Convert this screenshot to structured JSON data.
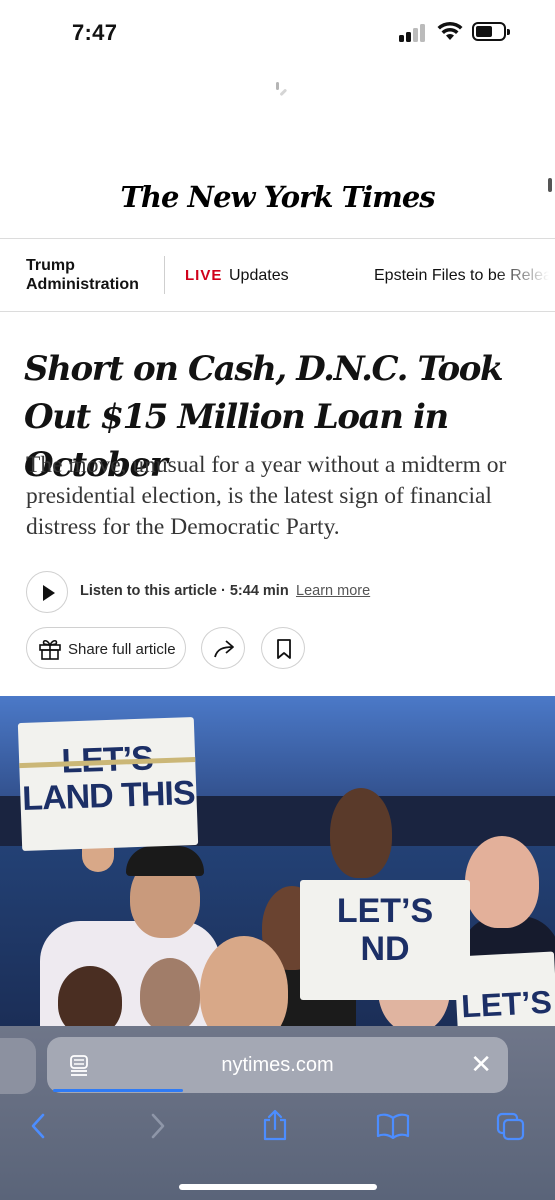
{
  "status_bar": {
    "time": "7:47"
  },
  "masthead": {
    "title": "The New York Times"
  },
  "ticker": {
    "section_line1": "Trump",
    "section_line2": "Administration",
    "live": "LIVE",
    "updates": "Updates",
    "next_item": "Epstein Files to be Releas"
  },
  "article": {
    "headline": "Short on Cash, D.N.C. Took Out $15 Million Loan in October",
    "summary": "The move, unusual for a year without a midterm or presidential election, is the latest sign of financial distress for the Democratic Party.",
    "listen_label": "Listen to this article · 5:44 min",
    "learn_more": "Learn more",
    "share_label": "Share full article"
  },
  "photo": {
    "sign_left_line1": "LET’S",
    "sign_left_line2": "LAND THIS",
    "sign_mid_line1": "LET’S",
    "sign_mid_line2": "ND",
    "sign_right": "LET’S"
  },
  "browser": {
    "url": "nytimes.com",
    "accent_color": "#2f7bf5"
  },
  "icons": [
    "play-icon",
    "gift-icon",
    "share-arrow-icon",
    "bookmark-icon",
    "reader-icon",
    "close-icon",
    "back-icon",
    "forward-icon",
    "share-icon",
    "bookmarks-icon",
    "tabs-icon"
  ]
}
